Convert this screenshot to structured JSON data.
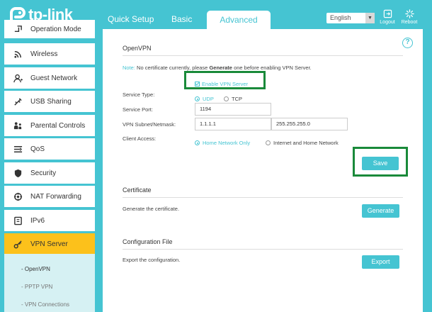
{
  "header": {
    "brand": "tp-link",
    "tabs": [
      "Quick Setup",
      "Basic",
      "Advanced"
    ],
    "language": "English",
    "logout": "Logout",
    "reboot": "Reboot"
  },
  "sidebar": {
    "items": [
      {
        "label": "Operation Mode",
        "icon": "operation-mode-icon"
      },
      {
        "label": "Wireless",
        "icon": "wifi-icon"
      },
      {
        "label": "Guest Network",
        "icon": "guest-user-icon"
      },
      {
        "label": "USB Sharing",
        "icon": "usb-icon"
      },
      {
        "label": "Parental Controls",
        "icon": "family-icon"
      },
      {
        "label": "QoS",
        "icon": "qos-icon"
      },
      {
        "label": "Security",
        "icon": "shield-icon"
      },
      {
        "label": "NAT Forwarding",
        "icon": "nat-icon"
      },
      {
        "label": "IPv6",
        "icon": "ipv6-icon"
      },
      {
        "label": "VPN Server",
        "icon": "vpn-key-icon"
      }
    ],
    "submenu": [
      "- OpenVPN",
      "- PPTP VPN",
      "- VPN Connections"
    ]
  },
  "openvpn": {
    "title": "OpenVPN",
    "note_label": "Note:",
    "note_pre": "No certificate currently, please",
    "note_bold": "Generate",
    "note_post": "one before enabling VPN Server.",
    "enable_label": "Enable VPN Server",
    "service_type_label": "Service Type:",
    "service_type_options": [
      "UDP",
      "TCP"
    ],
    "service_port_label": "Service Port:",
    "service_port": "1194",
    "subnet_label": "VPN Subnet/Netmask:",
    "subnet": "1.1.1.1",
    "netmask": "255.255.255.0",
    "client_access_label": "Client Access:",
    "client_access_options": [
      "Home Network Only",
      "Internet and Home Network"
    ],
    "save_label": "Save"
  },
  "certificate": {
    "title": "Certificate",
    "desc": "Generate the certificate.",
    "button": "Generate"
  },
  "config_file": {
    "title": "Configuration File",
    "desc": "Export the configuration.",
    "button": "Export"
  },
  "colors": {
    "accent": "#45c4d2",
    "active_menu": "#fcc11b",
    "highlight_box": "#1a8a3a"
  }
}
